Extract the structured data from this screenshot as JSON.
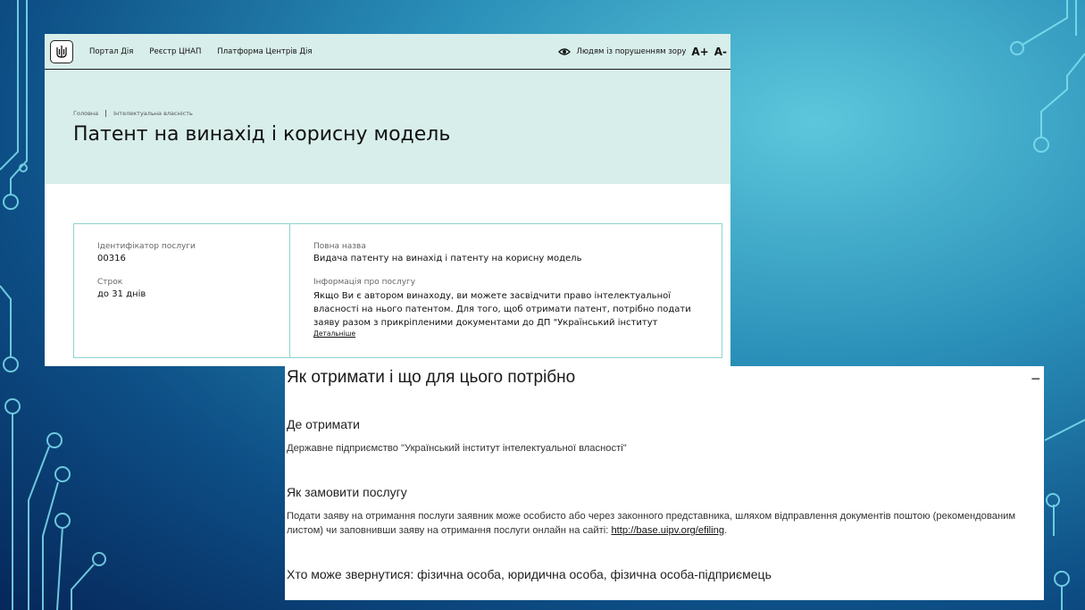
{
  "nav": {
    "links": [
      "Портал Дія",
      "Реєстр ЦНАП",
      "Платформа Центрів Дія"
    ],
    "accessibility": "Людям із порушенням зору",
    "font_increase": "A+",
    "font_decrease": "A-"
  },
  "breadcrumb": {
    "home": "Головна",
    "section": "Інтелектуальна власність"
  },
  "page_title": "Патент на винахід і корисну модель",
  "card": {
    "id_label": "Ідентифікатор послуги",
    "id_value": "00316",
    "term_label": "Строк",
    "term_value": "до 31 днів",
    "fullname_label": "Повна назва",
    "fullname_value": "Видача патенту на винахід і патенту на корисну модель",
    "info_label": "Інформація про послугу",
    "info_value": "Якщо Ви є автором винаходу, ви можете засвідчити право інтелектуальної власності на нього патентом. Для того, щоб отримати патент, потрібно подати заяву разом з прикріпленими документами до ДП \"Український інститут",
    "more_link": "Детальніше"
  },
  "how": {
    "title": "Як отримати і що для цього потрібно",
    "collapse": "−",
    "where_heading": "Де отримати",
    "where_text": "Державне підприємство \"Український інститут інтелектуальної власності\"",
    "order_heading": "Як замовити послугу",
    "order_text": "Подати заяву на отримання послуги заявник може особисто або через законного представника, шляхом відправлення документів поштою (рекомендованим листом) чи заповнивши заяву на отримання послуги онлайн на сайті: ",
    "order_link": "http://base.uipv.org/efiling",
    "who_heading": "Хто може звернутися: фізична особа, юридична особа, фізична особа-підприємець"
  }
}
